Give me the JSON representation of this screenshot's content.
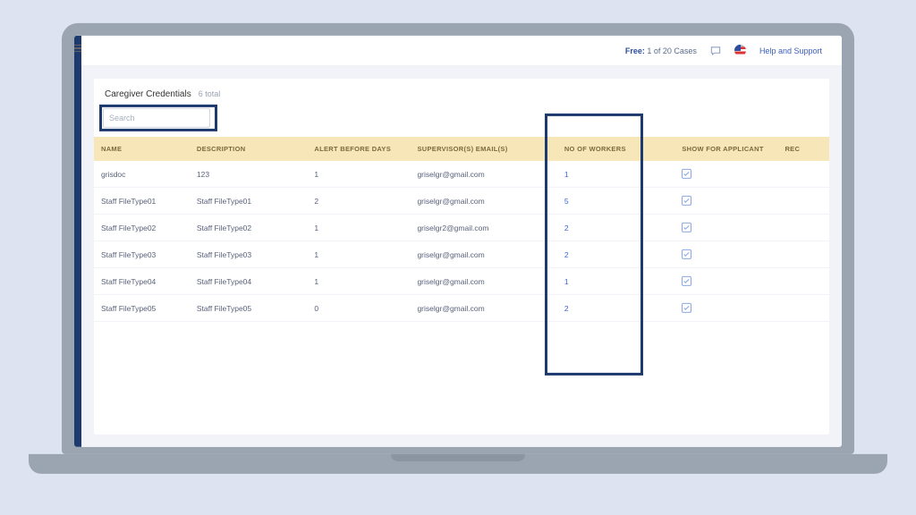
{
  "topbar": {
    "free_label": "Free:",
    "cases_text": "1 of 20 Cases",
    "help_label": "Help and Support"
  },
  "panel": {
    "title": "Caregiver Credentials",
    "count_text": "6 total"
  },
  "search": {
    "placeholder": "Search"
  },
  "table": {
    "headers": {
      "name": "NAME",
      "description": "DESCRIPTION",
      "alert_before": "ALERT BEFORE DAYS",
      "supervisor_emails": "SUPERVISOR(S) EMAIL(S)",
      "no_of_workers": "NO OF WORKERS",
      "show_for_applicant": "SHOW FOR APPLICANT",
      "rec": "REC"
    },
    "rows": [
      {
        "name": "grisdoc",
        "description": "123",
        "alert": "1",
        "email": "griselgr@gmail.com",
        "workers": "1",
        "show": true
      },
      {
        "name": "Staff FileType01",
        "description": "Staff FileType01",
        "alert": "2",
        "email": "griselgr@gmail.com",
        "workers": "5",
        "show": true
      },
      {
        "name": "Staff FileType02",
        "description": "Staff FileType02",
        "alert": "1",
        "email": "griselgr2@gmail.com",
        "workers": "2",
        "show": true
      },
      {
        "name": "Staff FileType03",
        "description": "Staff FileType03",
        "alert": "1",
        "email": "griselgr@gmail.com",
        "workers": "2",
        "show": true
      },
      {
        "name": "Staff FileType04",
        "description": "Staff FileType04",
        "alert": "1",
        "email": "griselgr@gmail.com",
        "workers": "1",
        "show": true
      },
      {
        "name": "Staff FileType05",
        "description": "Staff FileType05",
        "alert": "0",
        "email": "griselgr@gmail.com",
        "workers": "2",
        "show": true
      }
    ]
  }
}
